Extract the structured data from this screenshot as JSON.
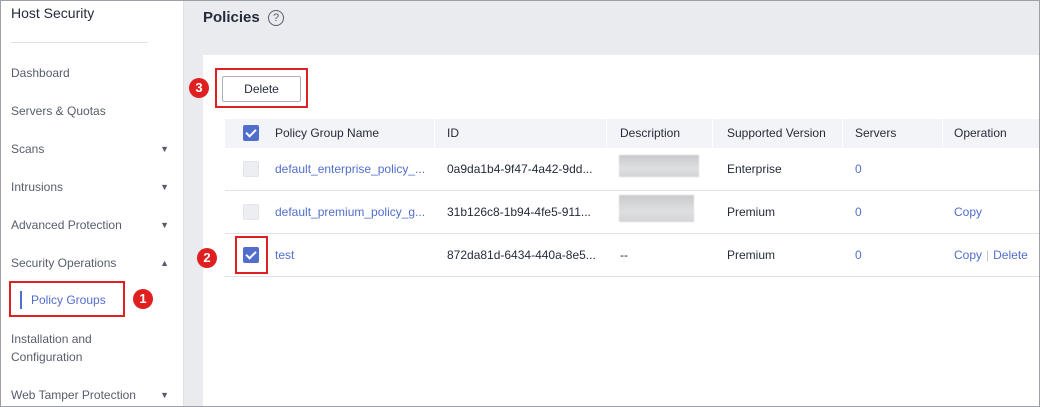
{
  "sidebar": {
    "title": "Host Security",
    "items": [
      {
        "label": "Dashboard"
      },
      {
        "label": "Servers & Quotas"
      },
      {
        "label": "Scans",
        "chevron": "▼"
      },
      {
        "label": "Intrusions",
        "chevron": "▼"
      },
      {
        "label": "Advanced Protection",
        "chevron": "▼"
      },
      {
        "label": "Security Operations",
        "chevron": "▲"
      },
      {
        "label": "Policy Groups"
      },
      {
        "label": "Installation and Configuration"
      },
      {
        "label": "Web Tamper Protection",
        "chevron": "▼"
      }
    ]
  },
  "header": {
    "title": "Policies",
    "help_glyph": "?"
  },
  "toolbar": {
    "delete_label": "Delete"
  },
  "table": {
    "columns": [
      "Policy Group Name",
      "ID",
      "Description",
      "Supported Version",
      "Servers",
      "Operation"
    ],
    "rows": [
      {
        "name": "default_enterprise_policy_...",
        "id": "0a9da1b4-9f47-4a42-9dd...",
        "description": "",
        "version": "Enterprise",
        "servers": "0",
        "op_copy": "",
        "op_delete": ""
      },
      {
        "name": "default_premium_policy_g...",
        "id": "31b126c8-1b94-4fe5-911...",
        "description": "",
        "version": "Premium",
        "servers": "0",
        "op_copy": "Copy",
        "op_delete": ""
      },
      {
        "name": "test",
        "id": "872da81d-6434-440a-8e5...",
        "description": "--",
        "version": "Premium",
        "servers": "0",
        "op_copy": "Copy",
        "op_delete": "Delete"
      }
    ]
  },
  "annotations": {
    "step1": "1",
    "step2": "2",
    "step3": "3"
  },
  "colors": {
    "accent": "#526ecc",
    "highlight": "#e02020"
  }
}
